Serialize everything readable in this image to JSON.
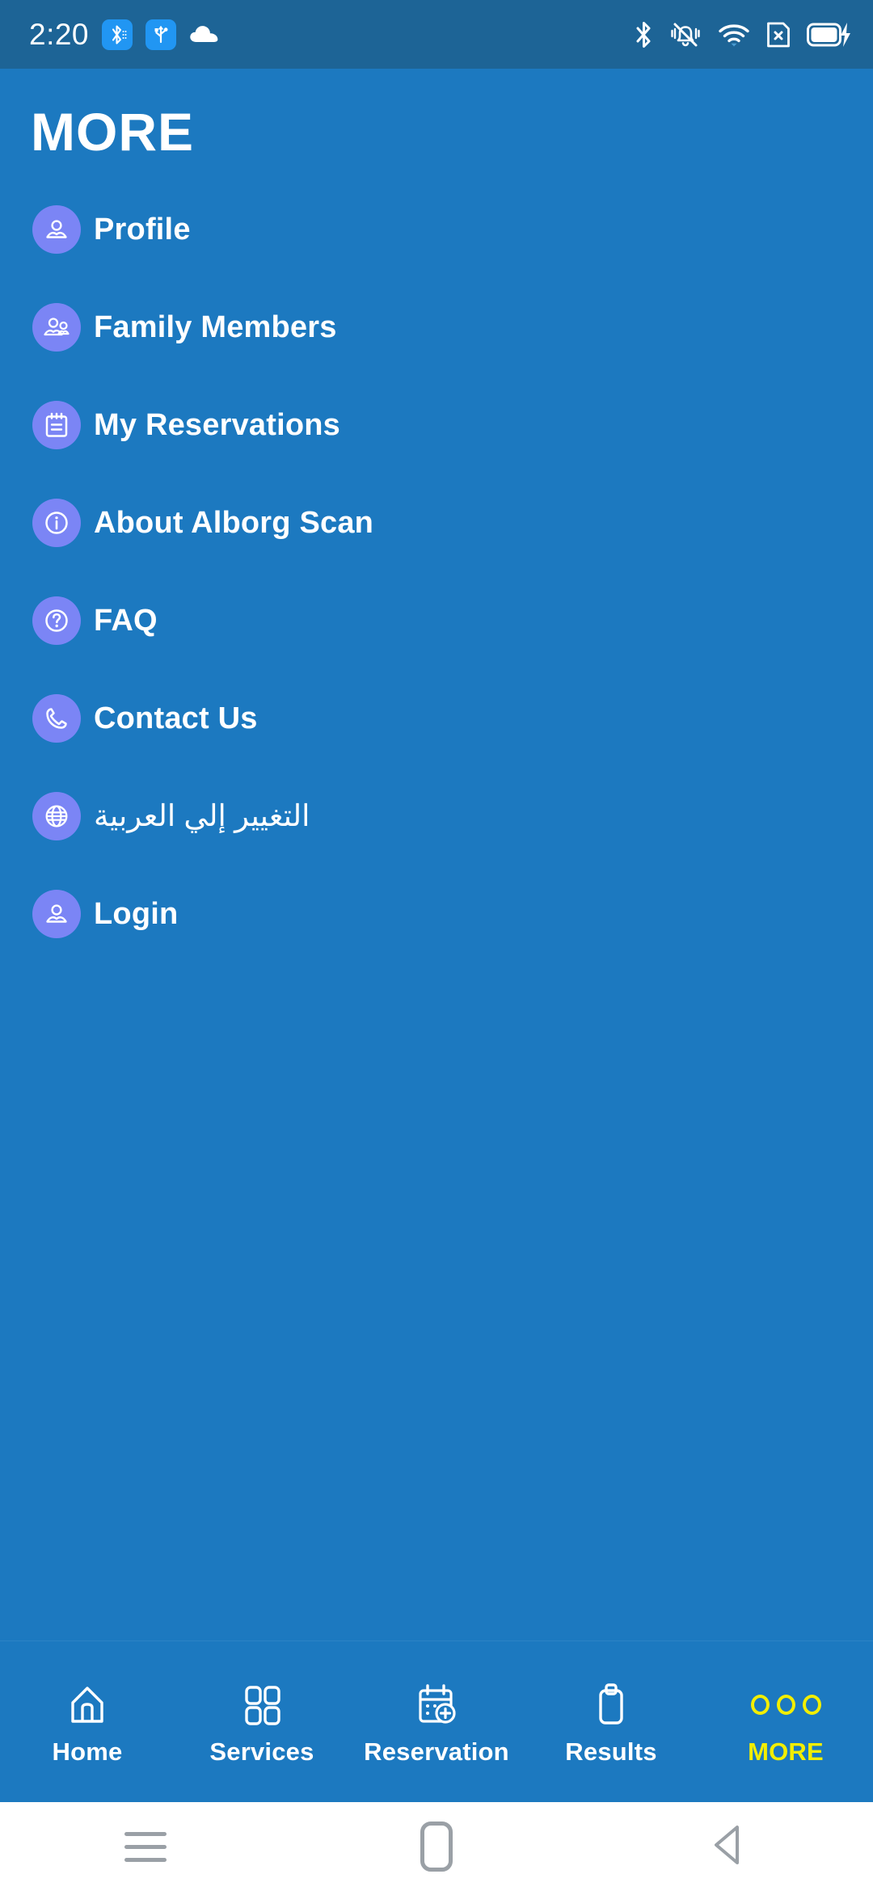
{
  "status_bar": {
    "time": "2:20",
    "left_icons": [
      "bluetooth-chip-icon",
      "usb-chip-icon",
      "cloud-icon"
    ],
    "right_icons": [
      "bluetooth-icon",
      "ringer-silent-icon",
      "wifi-icon",
      "sim-card-missing-icon",
      "battery-charging-icon"
    ]
  },
  "header": {
    "title": "MORE"
  },
  "theme": {
    "background": "#1c79c0",
    "status_bar_background": "#1d6496",
    "icon_circle": "#7b85f5",
    "text": "#ffffff",
    "active_tab": "#f2ee00"
  },
  "menu": {
    "items": [
      {
        "label": "Profile",
        "icon": "person-icon"
      },
      {
        "label": "Family Members",
        "icon": "people-group-icon"
      },
      {
        "label": "My Reservations",
        "icon": "notepad-icon"
      },
      {
        "label": "About Alborg Scan",
        "icon": "info-circle-icon"
      },
      {
        "label": "FAQ",
        "icon": "question-circle-icon"
      },
      {
        "label": "Contact Us",
        "icon": "phone-icon"
      },
      {
        "label": "التغيير إلي العربية",
        "icon": "globe-icon",
        "rtl": true
      },
      {
        "label": "Login",
        "icon": "person-icon"
      }
    ]
  },
  "bottom_nav": {
    "tabs": [
      {
        "label": "Home",
        "icon": "house-icon",
        "active": false
      },
      {
        "label": "Services",
        "icon": "grid-squares-icon",
        "active": false
      },
      {
        "label": "Reservation",
        "icon": "calendar-plus-icon",
        "active": false
      },
      {
        "label": "Results",
        "icon": "clipboard-icon",
        "active": false
      },
      {
        "label": "MORE",
        "icon": "three-dots-icon",
        "active": true
      }
    ]
  },
  "system_nav": {
    "buttons": [
      "recents-button",
      "home-button",
      "back-button"
    ]
  }
}
